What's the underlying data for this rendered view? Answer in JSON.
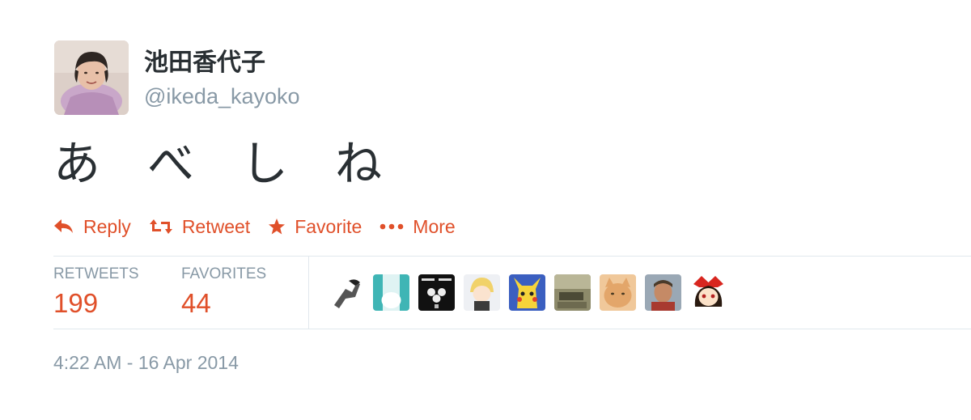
{
  "user": {
    "display_name": "池田香代子",
    "handle": "@ikeda_kayoko"
  },
  "tweet": {
    "text": "あ　べ　し　ね"
  },
  "actions": [
    {
      "label": "Reply",
      "icon": "reply-icon"
    },
    {
      "label": "Retweet",
      "icon": "retweet-icon"
    },
    {
      "label": "Favorite",
      "icon": "star-icon"
    },
    {
      "label": "More",
      "icon": "more-dots-icon"
    }
  ],
  "stats": {
    "retweets_label": "RETWEETS",
    "retweets_count": "199",
    "favorites_label": "FAVORITES",
    "favorites_count": "44"
  },
  "timestamp": "4:22 AM - 16 Apr 2014",
  "colors": {
    "accent": "#e0502a",
    "muted": "#8899a6",
    "text": "#292f33",
    "divider": "#e1e8ed"
  }
}
